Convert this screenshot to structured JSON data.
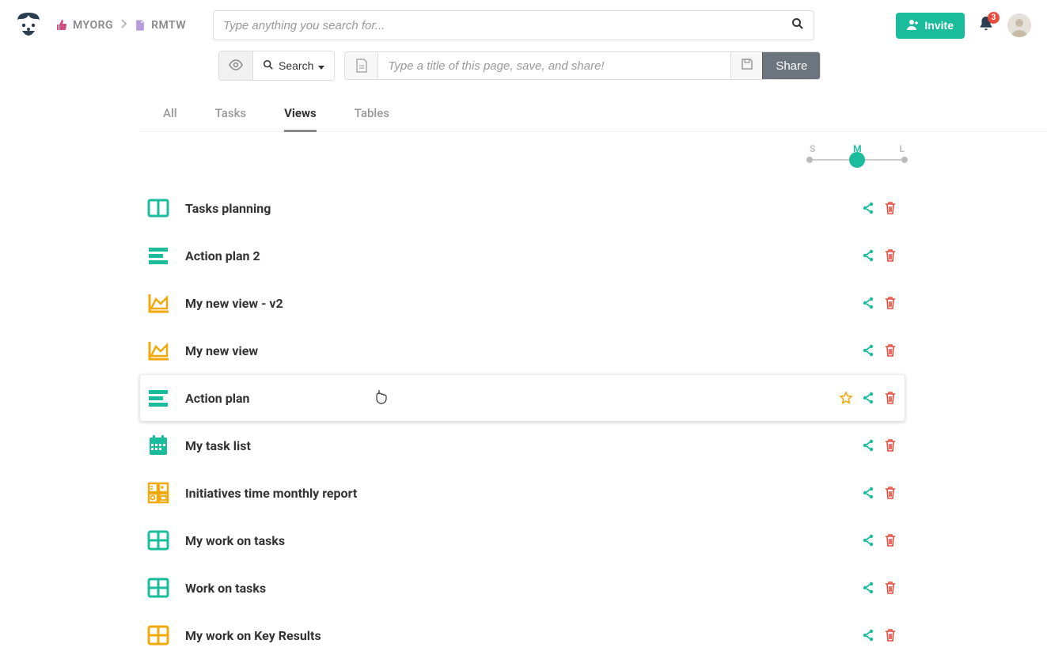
{
  "breadcrumb": {
    "org": "MYORG",
    "project": "RMTW"
  },
  "search": {
    "placeholder": "Type anything you search for..."
  },
  "topright": {
    "invite_label": "Invite",
    "notification_count": "3"
  },
  "secondbar": {
    "search_label": "Search",
    "title_placeholder": "Type a title of this page, save, and share!",
    "share_label": "Share"
  },
  "tabs": {
    "all": "All",
    "tasks": "Tasks",
    "views": "Views",
    "tables": "Tables"
  },
  "sizer": {
    "s": "S",
    "m": "M",
    "l": "L",
    "active": "M"
  },
  "views": [
    {
      "icon": "kanban",
      "color": "#1abc9c",
      "title": "Tasks planning"
    },
    {
      "icon": "list",
      "color": "#1abc9c",
      "title": "Action plan 2"
    },
    {
      "icon": "area-chart",
      "color": "#f1a90d",
      "title": "My new view - v2"
    },
    {
      "icon": "area-chart",
      "color": "#f1a90d",
      "title": "My new view"
    },
    {
      "icon": "list",
      "color": "#1abc9c",
      "title": "Action plan",
      "hovered": true
    },
    {
      "icon": "calendar",
      "color": "#1abc9c",
      "title": "My task list"
    },
    {
      "icon": "dashboard",
      "color": "#f1a90d",
      "title": "Initiatives time monthly report"
    },
    {
      "icon": "grid",
      "color": "#1abc9c",
      "title": "My work on tasks"
    },
    {
      "icon": "grid",
      "color": "#1abc9c",
      "title": "Work on tasks"
    },
    {
      "icon": "grid",
      "color": "#f1a90d",
      "title": "My work on Key Results"
    }
  ]
}
